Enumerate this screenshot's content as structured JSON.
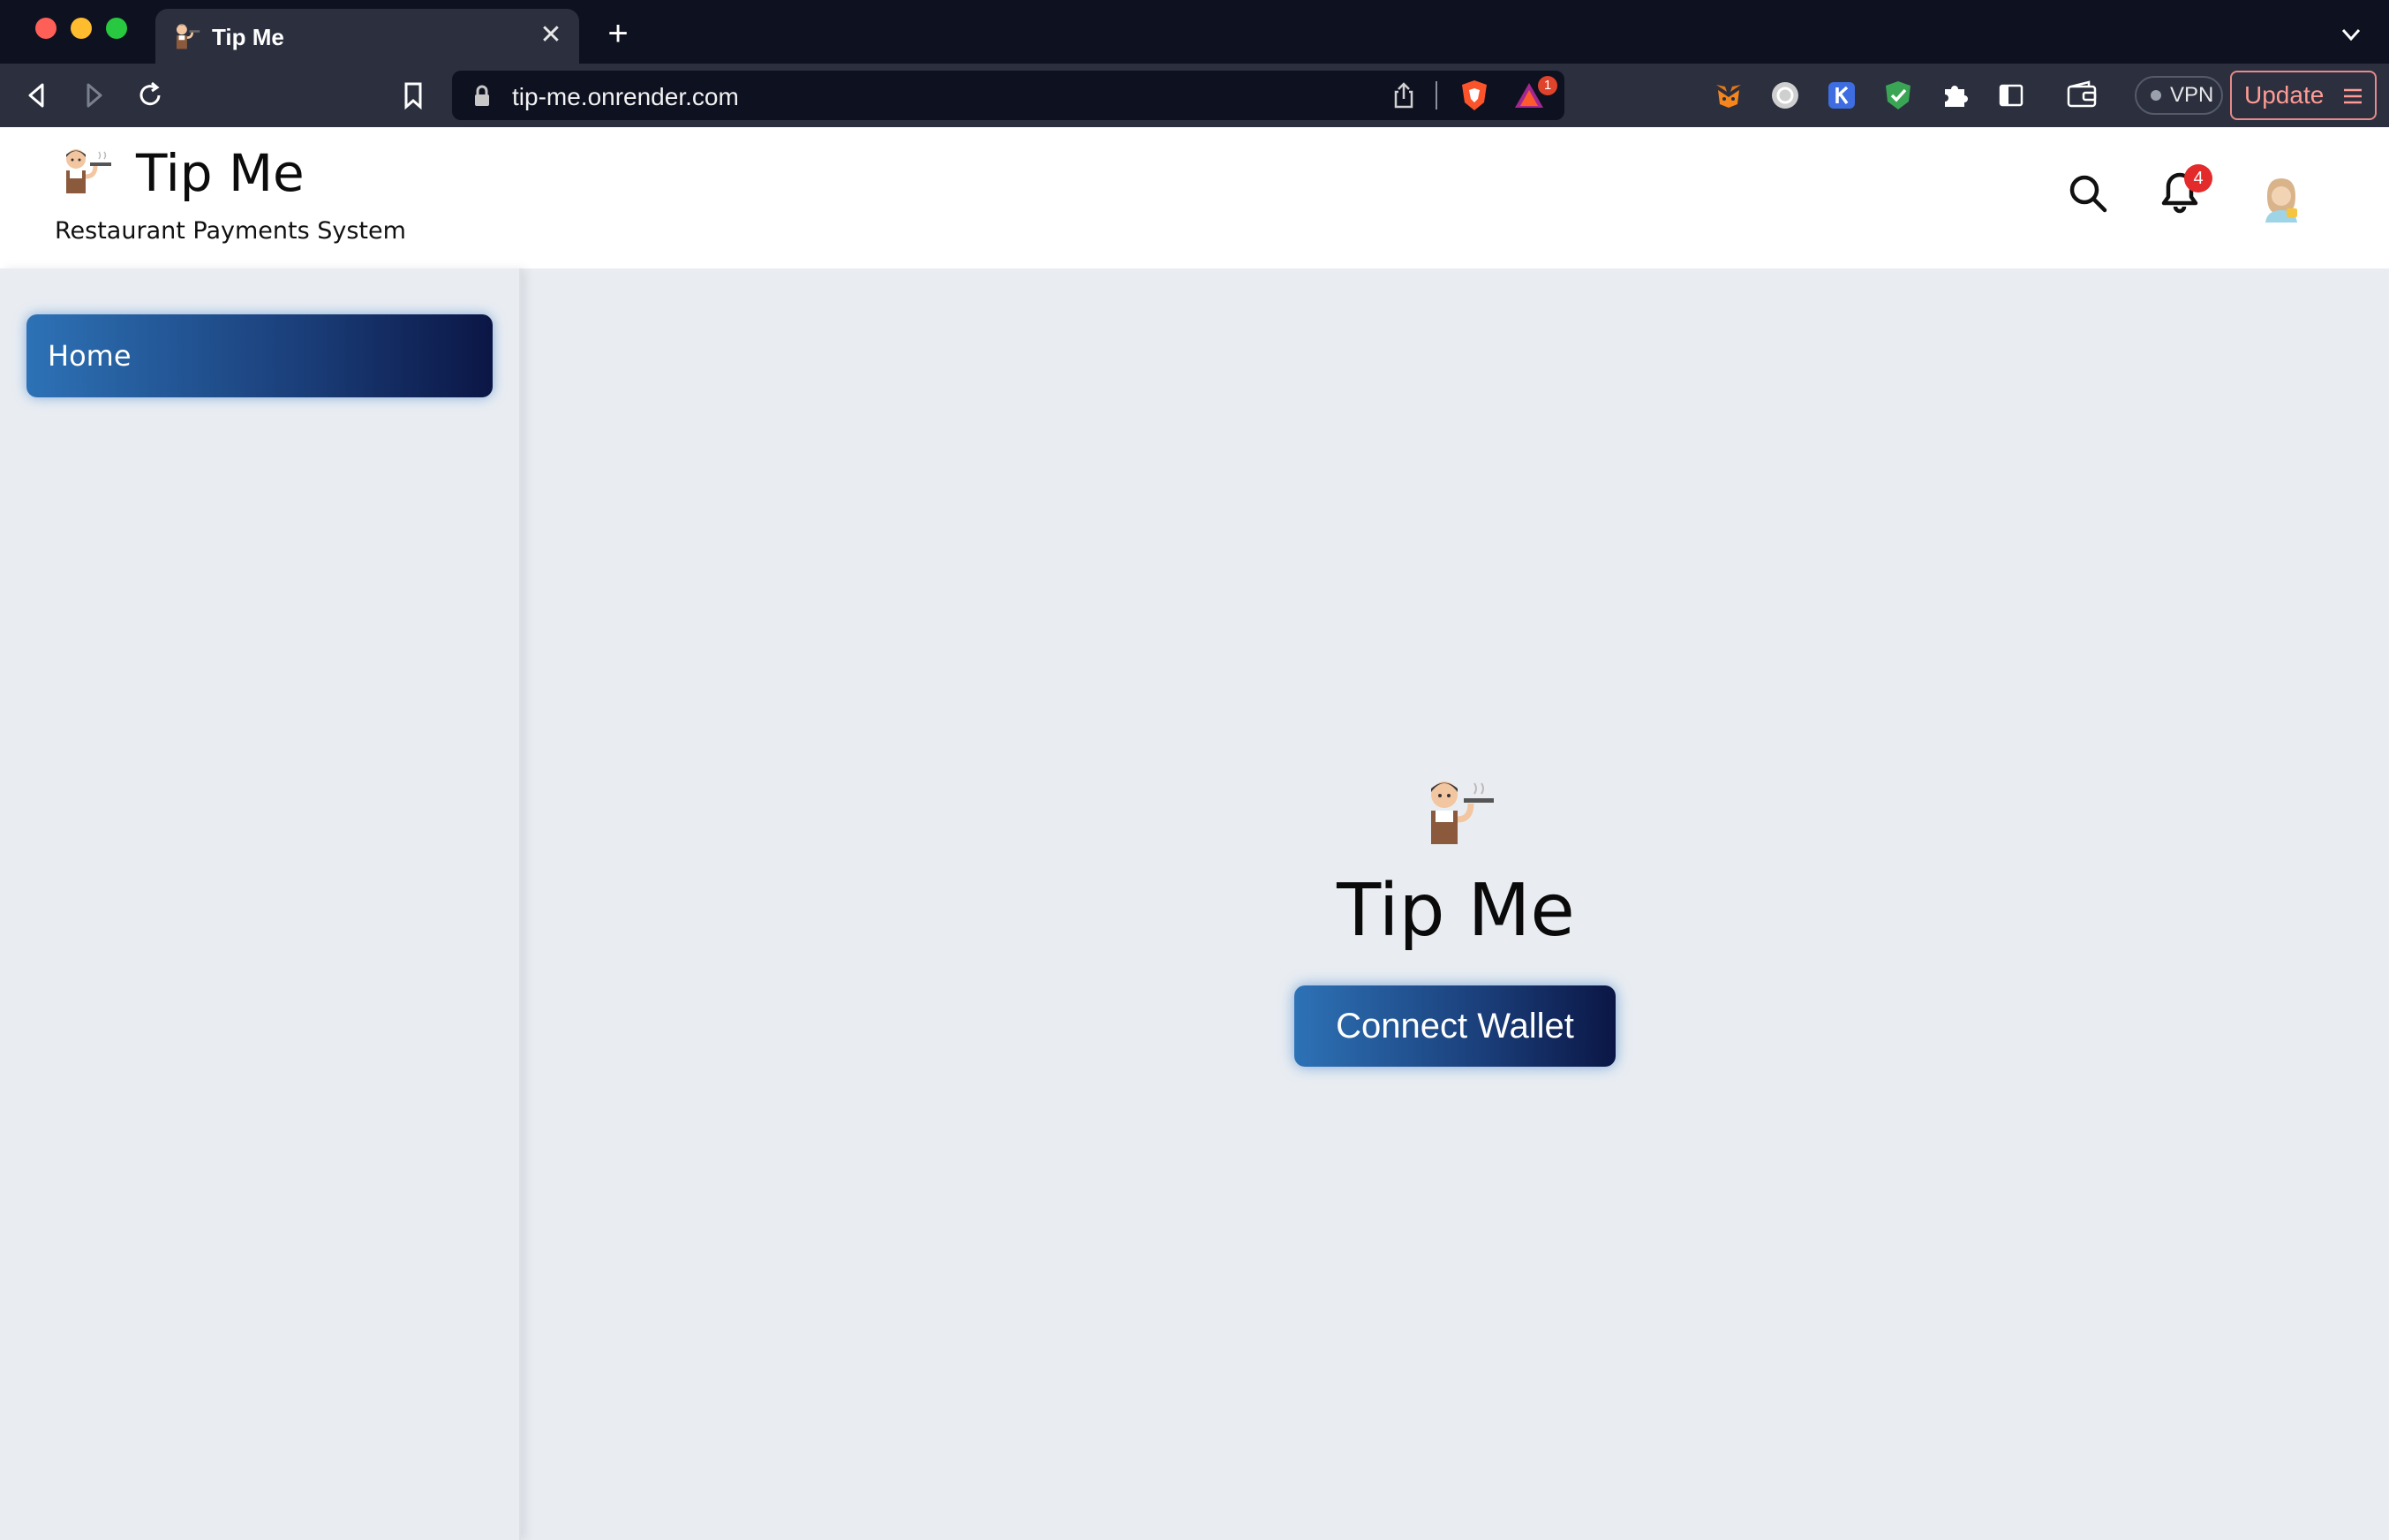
{
  "browser": {
    "tab_title": "Tip Me",
    "tab_close_glyph": "✕",
    "new_tab_glyph": "+",
    "url": "tip-me.onrender.com",
    "rewards_badge": "1",
    "vpn_label": "VPN",
    "update_label": "Update"
  },
  "header": {
    "title": "Tip Me",
    "subtitle": "Restaurant Payments System",
    "notification_count": "4"
  },
  "sidebar": {
    "items": [
      {
        "label": "Home",
        "active": true
      }
    ]
  },
  "main": {
    "title": "Tip Me",
    "connect_label": "Connect Wallet"
  },
  "colors": {
    "accent_start": "#2d72b6",
    "accent_end": "#0b1645",
    "page_bg": "#e9edf2",
    "badge": "#e32b2b"
  },
  "icons": [
    "waiter-icon",
    "search-icon",
    "bell-icon",
    "avatar-icon",
    "lock-icon",
    "share-icon",
    "brave-shield-icon",
    "brave-rewards-icon",
    "metamask-icon",
    "puzzle-icon",
    "sidebar-icon",
    "wallet-icon"
  ]
}
